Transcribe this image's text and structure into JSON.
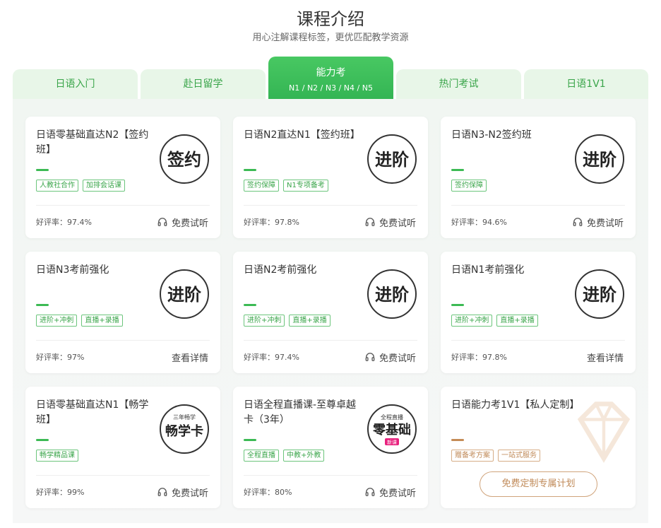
{
  "header": {
    "title": "课程介绍",
    "subtitle": "用心注解课程标签，更优匹配教学资源"
  },
  "tabs": [
    {
      "label": "日语入门"
    },
    {
      "label": "赴日留学"
    },
    {
      "label": "能力考",
      "sub": "N1 / N2 / N3 / N4 / N5",
      "active": true
    },
    {
      "label": "热门考试"
    },
    {
      "label": "日语1V1"
    }
  ],
  "cards": [
    {
      "name": "日语零基础直达N2【签约班】",
      "badge": "签约",
      "tags": [
        "人教社合作",
        "加排会话课"
      ],
      "rating": "好评率：97.4%",
      "action": "免费试听"
    },
    {
      "name": "日语N2直达N1【签约班】",
      "badge": "进阶",
      "tags": [
        "签约保障",
        "N1专项备考"
      ],
      "rating": "好评率：97.8%",
      "action": "免费试听"
    },
    {
      "name": "日语N3-N2签约班",
      "badge": "进阶",
      "tags": [
        "签约保障"
      ],
      "rating": "好评率：94.6%",
      "action": "免费试听"
    },
    {
      "name": "日语N3考前强化",
      "badge": "进阶",
      "tags": [
        "进阶+冲刺",
        "直播+录播"
      ],
      "rating": "好评率：97%",
      "action": "查看详情"
    },
    {
      "name": "日语N2考前强化",
      "badge": "进阶",
      "tags": [
        "进阶+冲刺",
        "直播+录播"
      ],
      "rating": "好评率：97.4%",
      "action": "免费试听"
    },
    {
      "name": "日语N1考前强化",
      "badge": "进阶",
      "tags": [
        "进阶+冲刺",
        "直播+录播"
      ],
      "rating": "好评率：97.8%",
      "action": "查看详情"
    },
    {
      "name": "日语零基础直达N1【畅学班】",
      "badge": "畅学卡",
      "badge_top": "三年畅学",
      "tags": [
        "畅学精品课"
      ],
      "rating": "好评率：99%",
      "action": "免费试听"
    },
    {
      "name": "日语全程直播课-至尊卓越卡（3年）",
      "badge": "零基础",
      "badge_top": "全程直播",
      "badge_bottom": "新课",
      "tags": [
        "全程直播",
        "中教+外教"
      ],
      "rating": "好评率：80%",
      "action": "免费试听"
    }
  ],
  "special_card": {
    "name": "日语能力考1V1【私人定制】",
    "tags": [
      "赠备考方案",
      "一站式服务"
    ],
    "cta": "免费定制专属计划"
  },
  "colors": {
    "accent": "#3cba54",
    "tab_bg": "#e8f6e8",
    "gold": "#c08a58"
  },
  "icons": {
    "action_free": "headphones-icon"
  }
}
